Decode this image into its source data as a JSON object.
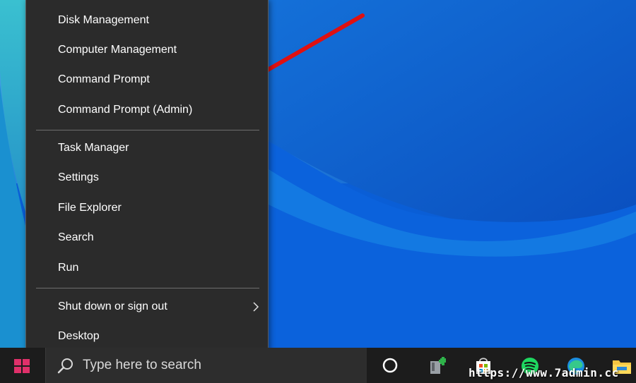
{
  "menu": {
    "items": [
      {
        "label": "Disk Management"
      },
      {
        "label": "Computer Management"
      },
      {
        "label": "Command Prompt"
      },
      {
        "label": "Command Prompt (Admin)"
      },
      {
        "label": "Task Manager"
      },
      {
        "label": "Settings"
      },
      {
        "label": "File Explorer"
      },
      {
        "label": "Search"
      },
      {
        "label": "Run"
      },
      {
        "label": "Shut down or sign out"
      },
      {
        "label": "Desktop"
      }
    ]
  },
  "taskbar": {
    "search_placeholder": "Type here to search",
    "icons": [
      "cortana-icon",
      "paint-bucket-icon",
      "store-icon",
      "spotify-icon",
      "edge-icon",
      "file-explorer-icon"
    ]
  },
  "annotation": {
    "color": "#e01010"
  },
  "watermark": "https://www.7admin.cc",
  "colors": {
    "menu_bg": "#2b2b2b",
    "taskbar_bg": "#1c1c1c",
    "desktop_blue": "#0a56c8",
    "start_logo": "#e0306a"
  }
}
